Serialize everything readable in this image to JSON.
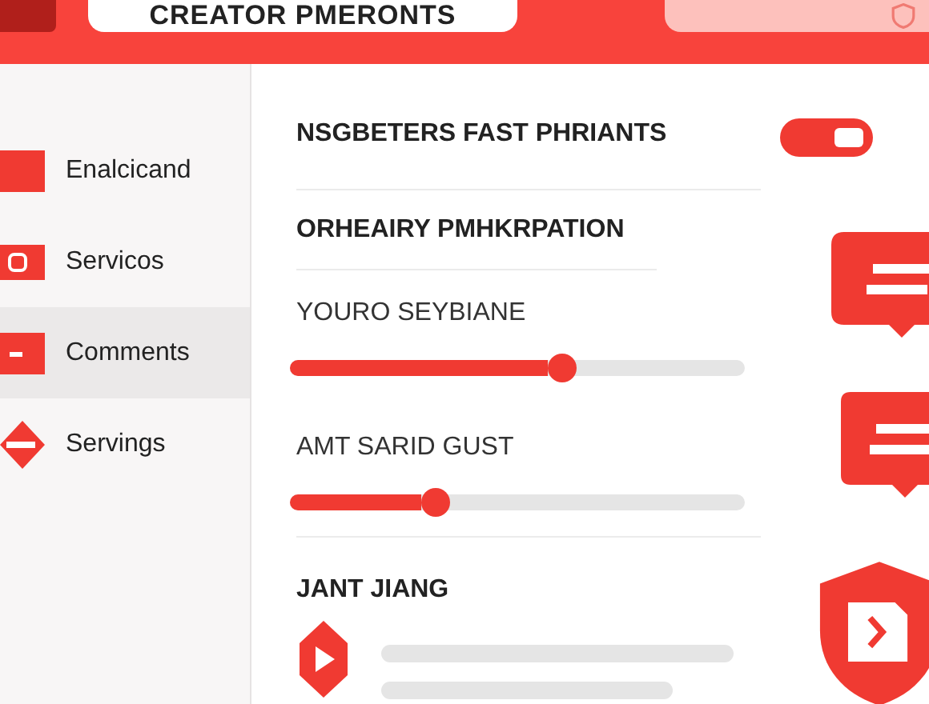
{
  "header": {
    "title": "CREATOR PMERONTS"
  },
  "sidebar": {
    "items": [
      {
        "label": "Enalcicand",
        "selected": false
      },
      {
        "label": "Servicos",
        "selected": false
      },
      {
        "label": "Comments",
        "selected": true
      },
      {
        "label": "Servings",
        "selected": false
      }
    ]
  },
  "settings": [
    {
      "kind": "toggle",
      "label": "NSGBETERS FAST PHRIANTS",
      "on": true
    },
    {
      "kind": "heading",
      "label": "ORHEAIRY PMHKRPATION"
    },
    {
      "kind": "slider",
      "label": "YOURO SEYBIANE",
      "level": 0.6
    },
    {
      "kind": "slider",
      "label": "AMT SARID GUST",
      "level": 0.32
    },
    {
      "kind": "profile",
      "label": "JANT JIANG"
    }
  ]
}
